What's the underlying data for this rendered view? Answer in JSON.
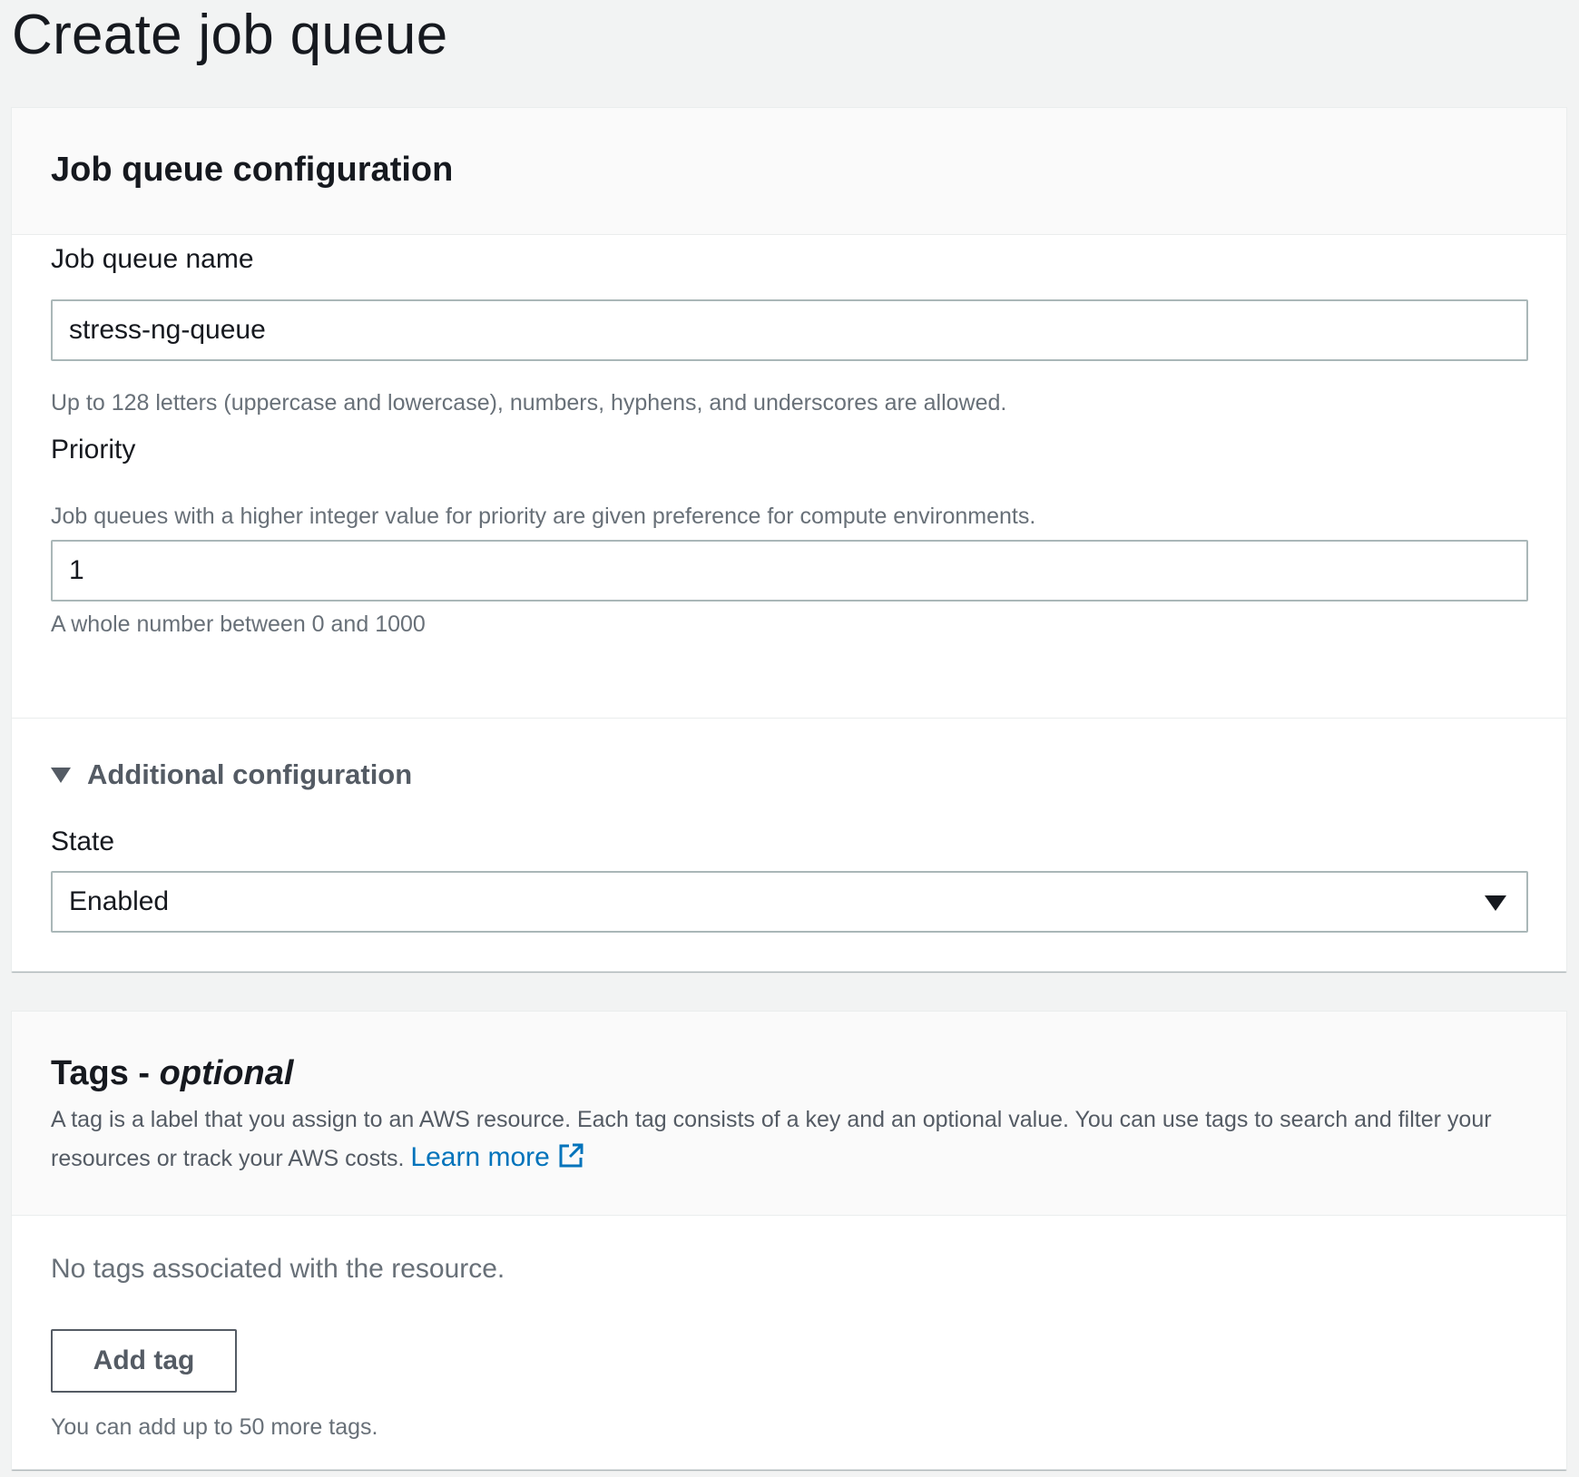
{
  "page": {
    "title": "Create job queue"
  },
  "config_panel": {
    "title": "Job queue configuration",
    "name_field": {
      "label": "Job queue name",
      "value": "stress-ng-queue",
      "hint": "Up to 128 letters (uppercase and lowercase), numbers, hyphens, and underscores are allowed."
    },
    "priority_field": {
      "label": "Priority",
      "description": "Job queues with a higher integer value for priority are given preference for compute environments.",
      "value": "1",
      "hint": "A whole number between 0 and 1000"
    },
    "additional": {
      "label": "Additional configuration",
      "expanded": true,
      "state_field": {
        "label": "State",
        "selected": "Enabled"
      }
    }
  },
  "tags_panel": {
    "title_main": "Tags - ",
    "title_optional": "optional",
    "description": "A tag is a label that you assign to an AWS resource. Each tag consists of a key and an optional value. You can use tags to search and filter your resources or track your AWS costs.",
    "learn_more": "Learn more",
    "empty_text": "No tags associated with the resource.",
    "add_button": "Add tag",
    "limit_hint": "You can add up to 50 more tags."
  },
  "colors": {
    "background": "#f2f3f3",
    "link": "#0073bb",
    "text": "#16191f",
    "secondary_text": "#687078"
  },
  "icons": {
    "external_link": "external-link-icon",
    "expand": "caret-down-icon",
    "select": "caret-down-icon"
  }
}
